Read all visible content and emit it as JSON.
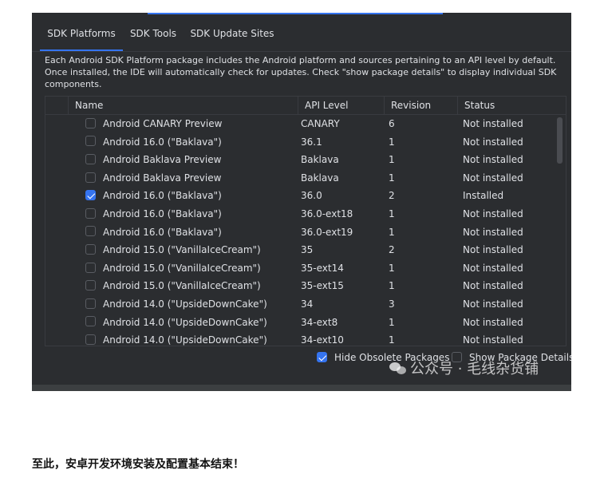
{
  "tabs": [
    {
      "label": "SDK Platforms"
    },
    {
      "label": "SDK Tools"
    },
    {
      "label": "SDK Update Sites"
    }
  ],
  "description": "Each Android SDK Platform package includes the Android platform and sources pertaining to an API level by default. Once installed, the IDE will automatically check for updates. Check \"show package details\" to display individual SDK components.",
  "table": {
    "headers": {
      "name": "Name",
      "api": "API Level",
      "revision": "Revision",
      "status": "Status"
    },
    "rows": [
      {
        "name": "Android CANARY Preview",
        "api": "CANARY",
        "revision": "6",
        "status": "Not installed",
        "checked": false
      },
      {
        "name": "Android 16.0 (\"Baklava\")",
        "api": "36.1",
        "revision": "1",
        "status": "Not installed",
        "checked": false
      },
      {
        "name": "Android Baklava Preview",
        "api": "Baklava",
        "revision": "1",
        "status": "Not installed",
        "checked": false
      },
      {
        "name": "Android Baklava Preview",
        "api": "Baklava",
        "revision": "1",
        "status": "Not installed",
        "checked": false
      },
      {
        "name": "Android 16.0 (\"Baklava\")",
        "api": "36.0",
        "revision": "2",
        "status": "Installed",
        "checked": true
      },
      {
        "name": "Android 16.0 (\"Baklava\")",
        "api": "36.0-ext18",
        "revision": "1",
        "status": "Not installed",
        "checked": false
      },
      {
        "name": "Android 16.0 (\"Baklava\")",
        "api": "36.0-ext19",
        "revision": "1",
        "status": "Not installed",
        "checked": false
      },
      {
        "name": "Android 15.0 (\"VanillaIceCream\")",
        "api": "35",
        "revision": "2",
        "status": "Not installed",
        "checked": false
      },
      {
        "name": "Android 15.0 (\"VanillaIceCream\")",
        "api": "35-ext14",
        "revision": "1",
        "status": "Not installed",
        "checked": false
      },
      {
        "name": "Android 15.0 (\"VanillaIceCream\")",
        "api": "35-ext15",
        "revision": "1",
        "status": "Not installed",
        "checked": false
      },
      {
        "name": "Android 14.0 (\"UpsideDownCake\")",
        "api": "34",
        "revision": "3",
        "status": "Not installed",
        "checked": false
      },
      {
        "name": "Android 14.0 (\"UpsideDownCake\")",
        "api": "34-ext8",
        "revision": "1",
        "status": "Not installed",
        "checked": false
      },
      {
        "name": "Android 14.0 (\"UpsideDownCake\")",
        "api": "34-ext10",
        "revision": "1",
        "status": "Not installed",
        "checked": false
      }
    ]
  },
  "options": {
    "hide_obsolete": {
      "label": "Hide Obsolete Packages",
      "checked": true
    },
    "show_details": {
      "label": "Show Package Details",
      "checked": false
    }
  },
  "watermark": "公众号 · 毛线杂货铺",
  "caption": "至此，安卓开发环境安装及配置基本结束！",
  "colors": {
    "panel_bg": "#2b2d30",
    "accent": "#3574f0",
    "text": "#dfe1e5"
  }
}
